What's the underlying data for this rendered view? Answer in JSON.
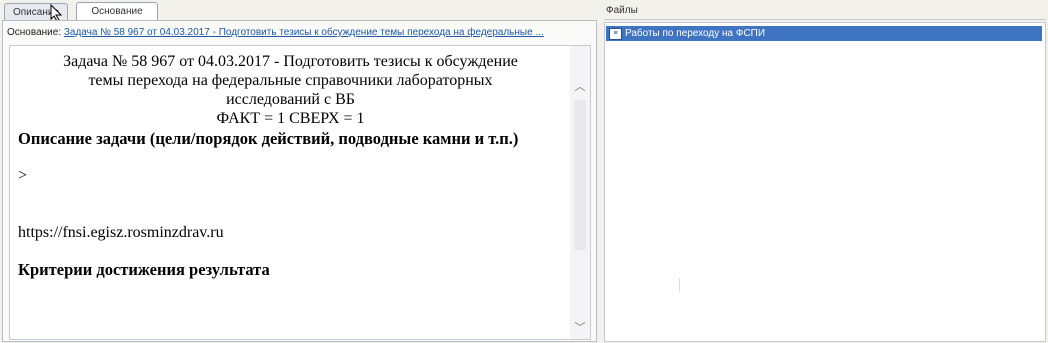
{
  "tabs": [
    {
      "label": "Описание"
    },
    {
      "label": "Основание"
    }
  ],
  "basis": {
    "label": "Основание:",
    "link": "Задача № 58 967 от 04.03.2017 - Подготовить тезисы к обсуждение темы перехода на федеральные ..."
  },
  "doc": {
    "title_line1": "Задача № 58 967 от 04.03.2017 - Подготовить тезисы к обсуждение",
    "title_line2": "темы перехода на федеральные справочники лабораторных",
    "title_line3": "исследований с ВБ",
    "title_line4": "ФАКТ = 1 СВЕРХ = 1",
    "heading": "Описание задачи (цели/порядок действий, подводные камни и т.п.)",
    "quote": ">",
    "url": "https://fnsi.egisz.rosminzdrav.ru",
    "criteria_heading": "Критерии достижения результата"
  },
  "files": {
    "header": "Файлы",
    "items": [
      {
        "label": "Работы по переходу на ФСПИ",
        "icon": "document-icon"
      }
    ]
  }
}
